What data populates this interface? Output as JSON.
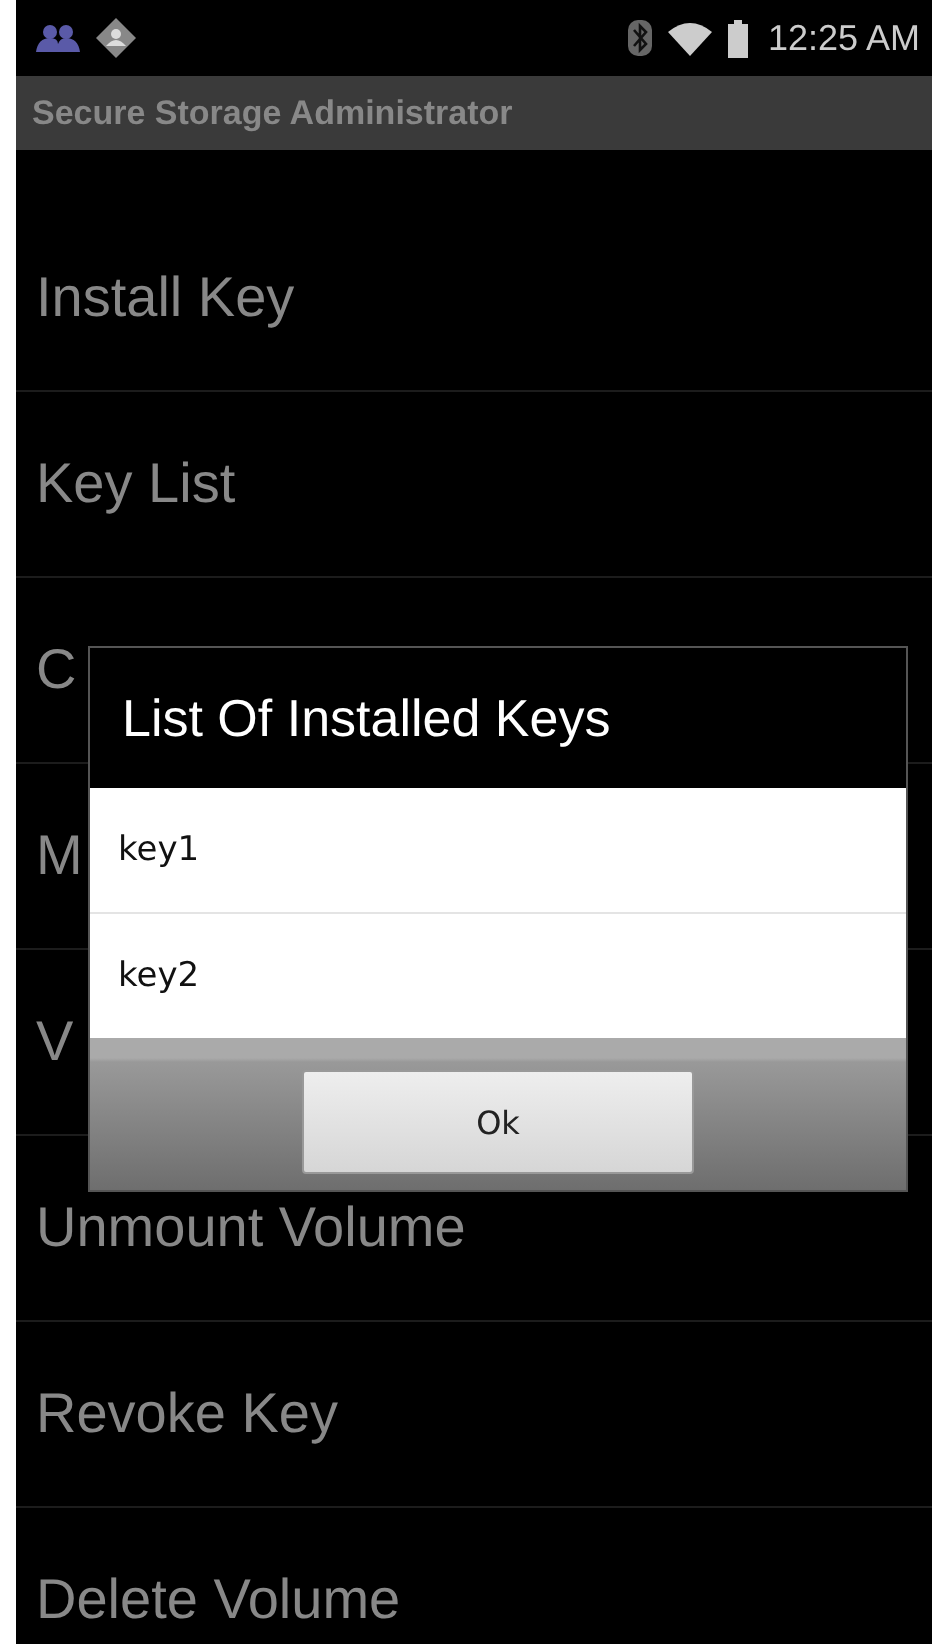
{
  "status_bar": {
    "time": "12:25 AM"
  },
  "action_bar": {
    "title": "Secure Storage Administrator"
  },
  "menu": [
    {
      "label": "Install Key"
    },
    {
      "label": "Key List"
    },
    {
      "label": "C"
    },
    {
      "label": "M"
    },
    {
      "label": "V"
    },
    {
      "label": "Unmount Volume"
    },
    {
      "label": "Revoke Key"
    },
    {
      "label": "Delete Volume"
    }
  ],
  "dialog": {
    "title": "List Of Installed Keys",
    "items": [
      {
        "label": "key1"
      },
      {
        "label": "key2"
      }
    ],
    "button": "Ok"
  }
}
